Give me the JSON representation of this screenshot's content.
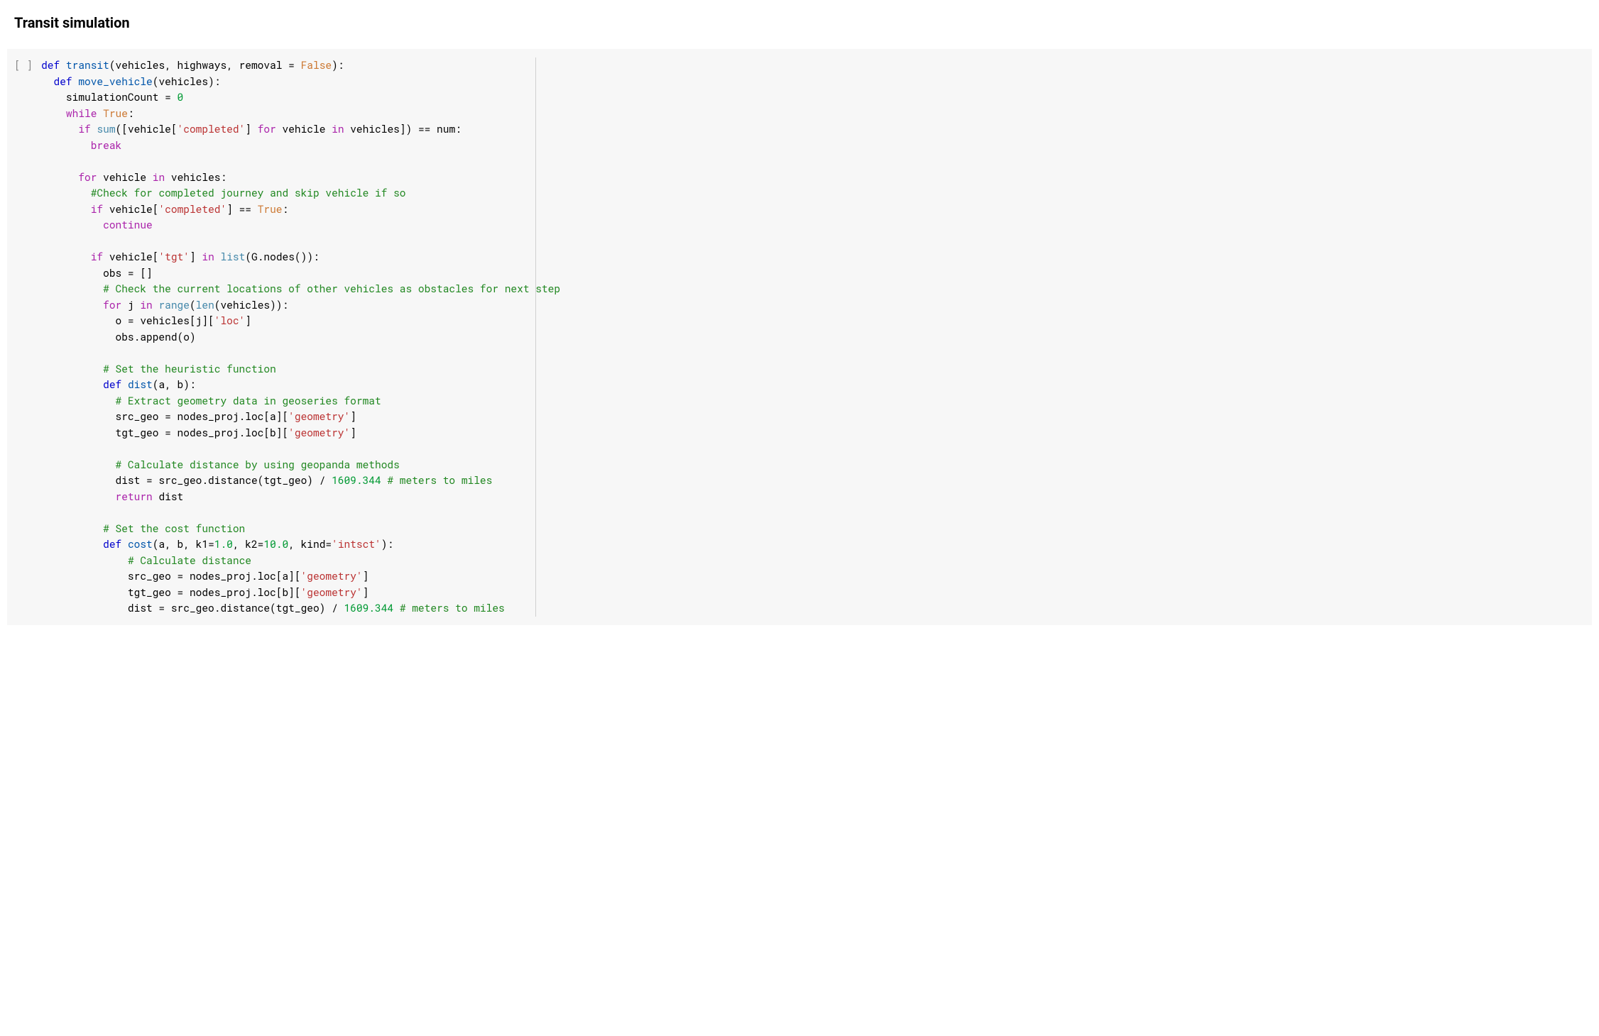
{
  "heading": "Transit simulation",
  "cell": {
    "gutter": "[ ]",
    "vertical_rule_ch": 80,
    "code": [
      [
        {
          "t": "def ",
          "c": "kw-blue"
        },
        {
          "t": "transit",
          "c": "fn-blue"
        },
        {
          "t": "(vehicles, highways, removal = "
        },
        {
          "t": "False",
          "c": "kw-orange"
        },
        {
          "t": "):"
        }
      ],
      [
        {
          "t": "  "
        },
        {
          "t": "def ",
          "c": "kw-blue"
        },
        {
          "t": "move_vehicle",
          "c": "fn-blue"
        },
        {
          "t": "(vehicles):"
        }
      ],
      [
        {
          "t": "    simulationCount = "
        },
        {
          "t": "0",
          "c": "num-green"
        }
      ],
      [
        {
          "t": "    "
        },
        {
          "t": "while ",
          "c": "kw-purple"
        },
        {
          "t": "True",
          "c": "kw-orange"
        },
        {
          "t": ":"
        }
      ],
      [
        {
          "t": "      "
        },
        {
          "t": "if ",
          "c": "kw-purple"
        },
        {
          "t": "sum",
          "c": "fn-teal"
        },
        {
          "t": "([vehicle["
        },
        {
          "t": "'completed'",
          "c": "str-red"
        },
        {
          "t": "] "
        },
        {
          "t": "for ",
          "c": "kw-purple"
        },
        {
          "t": "vehicle "
        },
        {
          "t": "in ",
          "c": "kw-purple"
        },
        {
          "t": "vehicles]) == num:"
        }
      ],
      [
        {
          "t": "        "
        },
        {
          "t": "break",
          "c": "kw-purple"
        }
      ],
      [
        {
          "t": ""
        }
      ],
      [
        {
          "t": "      "
        },
        {
          "t": "for ",
          "c": "kw-purple"
        },
        {
          "t": "vehicle "
        },
        {
          "t": "in ",
          "c": "kw-purple"
        },
        {
          "t": "vehicles:"
        }
      ],
      [
        {
          "t": "        "
        },
        {
          "t": "#Check for completed journey and skip vehicle if so",
          "c": "comment-green"
        }
      ],
      [
        {
          "t": "        "
        },
        {
          "t": "if ",
          "c": "kw-purple"
        },
        {
          "t": "vehicle["
        },
        {
          "t": "'completed'",
          "c": "str-red"
        },
        {
          "t": "] == "
        },
        {
          "t": "True",
          "c": "kw-orange"
        },
        {
          "t": ":"
        }
      ],
      [
        {
          "t": "          "
        },
        {
          "t": "continue",
          "c": "kw-purple"
        }
      ],
      [
        {
          "t": ""
        }
      ],
      [
        {
          "t": "        "
        },
        {
          "t": "if ",
          "c": "kw-purple"
        },
        {
          "t": "vehicle["
        },
        {
          "t": "'tgt'",
          "c": "str-red"
        },
        {
          "t": "] "
        },
        {
          "t": "in ",
          "c": "kw-purple"
        },
        {
          "t": "list",
          "c": "fn-teal"
        },
        {
          "t": "(G.nodes()):"
        }
      ],
      [
        {
          "t": "          obs = []"
        }
      ],
      [
        {
          "t": "          "
        },
        {
          "t": "# Check the current locations of other vehicles as obstacles for next step",
          "c": "comment-green"
        }
      ],
      [
        {
          "t": "          "
        },
        {
          "t": "for ",
          "c": "kw-purple"
        },
        {
          "t": "j "
        },
        {
          "t": "in ",
          "c": "kw-purple"
        },
        {
          "t": "range",
          "c": "fn-teal"
        },
        {
          "t": "("
        },
        {
          "t": "len",
          "c": "fn-teal"
        },
        {
          "t": "(vehicles)):"
        }
      ],
      [
        {
          "t": "            o = vehicles[j]["
        },
        {
          "t": "'loc'",
          "c": "str-red"
        },
        {
          "t": "]"
        }
      ],
      [
        {
          "t": "            obs.append(o)"
        }
      ],
      [
        {
          "t": ""
        }
      ],
      [
        {
          "t": "          "
        },
        {
          "t": "# Set the heuristic function",
          "c": "comment-green"
        }
      ],
      [
        {
          "t": "          "
        },
        {
          "t": "def ",
          "c": "kw-blue"
        },
        {
          "t": "dist",
          "c": "fn-blue"
        },
        {
          "t": "(a, b):"
        }
      ],
      [
        {
          "t": "            "
        },
        {
          "t": "# Extract geometry data in geoseries format",
          "c": "comment-green"
        }
      ],
      [
        {
          "t": "            src_geo = nodes_proj.loc[a]["
        },
        {
          "t": "'geometry'",
          "c": "str-red"
        },
        {
          "t": "]"
        }
      ],
      [
        {
          "t": "            tgt_geo = nodes_proj.loc[b]["
        },
        {
          "t": "'geometry'",
          "c": "str-red"
        },
        {
          "t": "]"
        }
      ],
      [
        {
          "t": ""
        }
      ],
      [
        {
          "t": "            "
        },
        {
          "t": "# Calculate distance by using geopanda methods",
          "c": "comment-green"
        }
      ],
      [
        {
          "t": "            dist = src_geo.distance(tgt_geo) / "
        },
        {
          "t": "1609.344",
          "c": "num-green"
        },
        {
          "t": " "
        },
        {
          "t": "# meters to miles",
          "c": "comment-green"
        }
      ],
      [
        {
          "t": "            "
        },
        {
          "t": "return ",
          "c": "kw-purple"
        },
        {
          "t": "dist"
        }
      ],
      [
        {
          "t": ""
        }
      ],
      [
        {
          "t": "          "
        },
        {
          "t": "# Set the cost function",
          "c": "comment-green"
        }
      ],
      [
        {
          "t": "          "
        },
        {
          "t": "def ",
          "c": "kw-blue"
        },
        {
          "t": "cost",
          "c": "fn-blue"
        },
        {
          "t": "(a, b, k1="
        },
        {
          "t": "1.0",
          "c": "num-green"
        },
        {
          "t": ", k2="
        },
        {
          "t": "10.0",
          "c": "num-green"
        },
        {
          "t": ", kind="
        },
        {
          "t": "'intsct'",
          "c": "str-red"
        },
        {
          "t": "):"
        }
      ],
      [
        {
          "t": "              "
        },
        {
          "t": "# Calculate distance",
          "c": "comment-green"
        }
      ],
      [
        {
          "t": "              src_geo = nodes_proj.loc[a]["
        },
        {
          "t": "'geometry'",
          "c": "str-red"
        },
        {
          "t": "]"
        }
      ],
      [
        {
          "t": "              tgt_geo = nodes_proj.loc[b]["
        },
        {
          "t": "'geometry'",
          "c": "str-red"
        },
        {
          "t": "]"
        }
      ],
      [
        {
          "t": "              dist = src_geo.distance(tgt_geo) / "
        },
        {
          "t": "1609.344",
          "c": "num-green"
        },
        {
          "t": " "
        },
        {
          "t": "# meters to miles",
          "c": "comment-green"
        }
      ]
    ]
  }
}
